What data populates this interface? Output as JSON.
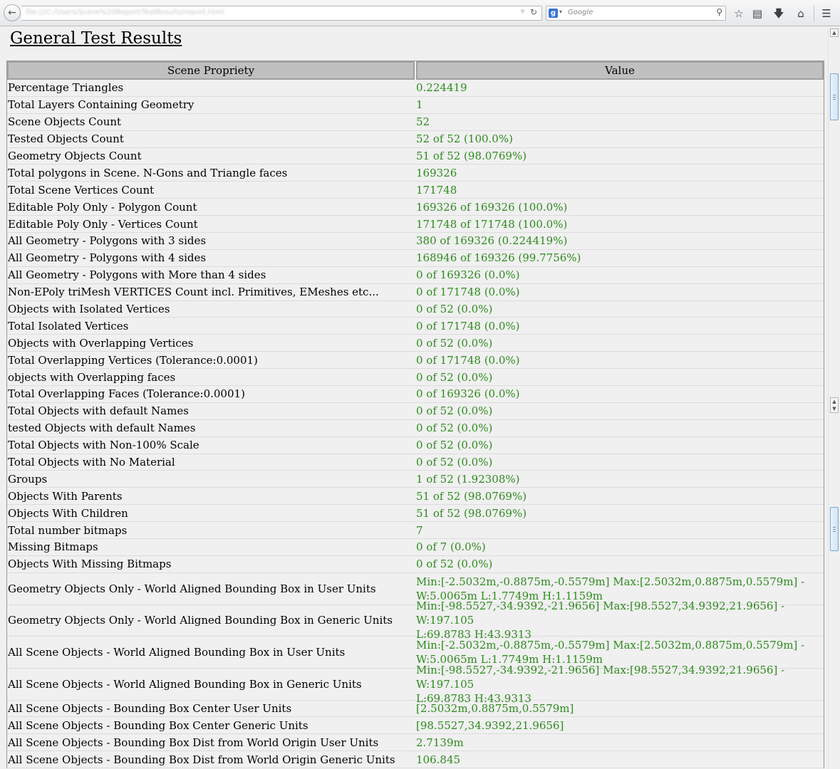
{
  "browser": {
    "address": "file:///C:/Users/Scene%20Report/TestResults/report.html",
    "search_engine_letter": "g",
    "search_placeholder": "Google",
    "icons": [
      "back-arrow-icon",
      "reload-icon",
      "search-engine-google-icon",
      "magnifier-icon",
      "star-icon",
      "clipboard-icon",
      "download-icon",
      "home-icon",
      "hamburger-menu-icon"
    ]
  },
  "page": {
    "title": "General Test Results"
  },
  "table": {
    "headers": [
      "Scene Propriety",
      "Value"
    ],
    "rows": [
      {
        "k": "Percentage Triangles",
        "v": "0.224419"
      },
      {
        "k": "Total Layers Containing Geometry",
        "v": "1"
      },
      {
        "k": "Scene Objects Count",
        "v": "52"
      },
      {
        "k": "Tested Objects Count",
        "v": "52 of 52 (100.0%)"
      },
      {
        "k": "Geometry Objects Count",
        "v": "51 of 52 (98.0769%)"
      },
      {
        "k": "Total polygons in Scene. N-Gons and Triangle faces",
        "v": "169326"
      },
      {
        "k": "Total Scene Vertices Count",
        "v": "171748"
      },
      {
        "k": "Editable Poly Only - Polygon Count",
        "v": "169326 of 169326 (100.0%)"
      },
      {
        "k": "Editable Poly Only - Vertices Count",
        "v": "171748 of 171748 (100.0%)"
      },
      {
        "k": "All Geometry - Polygons with 3 sides",
        "v": "380 of 169326 (0.224419%)"
      },
      {
        "k": "All Geometry - Polygons with 4 sides",
        "v": "168946 of 169326 (99.7756%)"
      },
      {
        "k": "All Geometry - Polygons with More than 4 sides",
        "v": "0 of 169326 (0.0%)"
      },
      {
        "k": "Non-EPoly triMesh VERTICES Count incl. Primitives, EMeshes etc...",
        "v": "0 of 171748 (0.0%)"
      },
      {
        "k": "Objects with Isolated Vertices",
        "v": "0 of 52 (0.0%)"
      },
      {
        "k": "Total Isolated Vertices",
        "v": "0 of 171748 (0.0%)"
      },
      {
        "k": "Objects with Overlapping Vertices",
        "v": "0 of 52 (0.0%)"
      },
      {
        "k": "Total Overlapping Vertices (Tolerance:0.0001)",
        "v": "0 of 171748 (0.0%)"
      },
      {
        "k": "objects with Overlapping faces",
        "v": "0 of 52 (0.0%)"
      },
      {
        "k": "Total Overlapping Faces (Tolerance:0.0001)",
        "v": "0 of 169326 (0.0%)"
      },
      {
        "k": "Total Objects with default Names",
        "v": "0 of 52 (0.0%)"
      },
      {
        "k": "tested Objects with default Names",
        "v": "0 of 52 (0.0%)"
      },
      {
        "k": "Total Objects with Non-100% Scale",
        "v": "0 of 52 (0.0%)"
      },
      {
        "k": "Total Objects with No Material",
        "v": "0 of 52 (0.0%)"
      },
      {
        "k": "Groups",
        "v": "1 of 52 (1.92308%)"
      },
      {
        "k": "Objects With Parents",
        "v": "51 of 52 (98.0769%)"
      },
      {
        "k": "Objects With Children",
        "v": "51 of 52 (98.0769%)"
      },
      {
        "k": "Total number bitmaps",
        "v": "7"
      },
      {
        "k": "Missing Bitmaps",
        "v": "0 of 7 (0.0%)"
      },
      {
        "k": "Objects With Missing Bitmaps",
        "v": "0 of 52 (0.0%)"
      },
      {
        "k": "Geometry Objects Only - World Aligned Bounding Box in User Units",
        "v": "Min:[-2.5032m,-0.8875m,-0.5579m] Max:[2.5032m,0.8875m,0.5579m] -\nW:5.0065m L:1.7749m H:1.1159m"
      },
      {
        "k": "Geometry Objects Only - World Aligned Bounding Box in Generic Units",
        "v": "Min:[-98.5527,-34.9392,-21.9656] Max:[98.5527,34.9392,21.9656] - W:197.105\nL:69.8783 H:43.9313"
      },
      {
        "k": "All Scene Objects - World Aligned Bounding Box in User Units",
        "v": "Min:[-2.5032m,-0.8875m,-0.5579m] Max:[2.5032m,0.8875m,0.5579m] -\nW:5.0065m L:1.7749m H:1.1159m"
      },
      {
        "k": "All Scene Objects - World Aligned Bounding Box in Generic Units",
        "v": "Min:[-98.5527,-34.9392,-21.9656] Max:[98.5527,34.9392,21.9656] - W:197.105\nL:69.8783 H:43.9313"
      },
      {
        "k": "All Scene Objects - Bounding Box Center User Units",
        "v": "[2.5032m,0.8875m,0.5579m]"
      },
      {
        "k": "All Scene Objects - Bounding Box Center Generic Units",
        "v": "[98.5527,34.9392,21.9656]"
      },
      {
        "k": "All Scene Objects - Bounding Box Dist from World Origin User Units",
        "v": "2.7139m"
      },
      {
        "k": "All Scene Objects - Bounding Box Dist from World Origin Generic Units",
        "v": "106.845"
      }
    ]
  },
  "colors": {
    "value_text": "#2e8b1e",
    "header_bg": "#c0c0c0",
    "page_bg": "#f0f0f0"
  }
}
